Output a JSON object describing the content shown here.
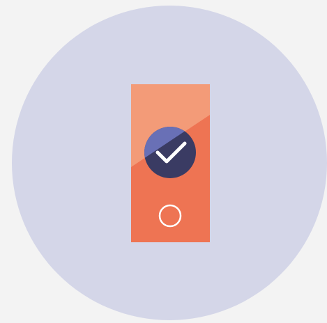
{
  "illustration": {
    "description_icon": "phone-checkmark-illustration",
    "colors": {
      "page_background": "#f3f3f3",
      "circle_background": "#d4d6e8",
      "device_body": "#ee7453",
      "device_highlight": "#f39b78",
      "check_badge_light": "#6970b6",
      "check_badge_dark": "#3a3b63",
      "checkmark": "#ffffff",
      "home_button_ring": "#ffffff"
    },
    "icons": {
      "device": "phone-icon",
      "badge": "checkmark-icon",
      "home_button": "circle-icon"
    }
  }
}
